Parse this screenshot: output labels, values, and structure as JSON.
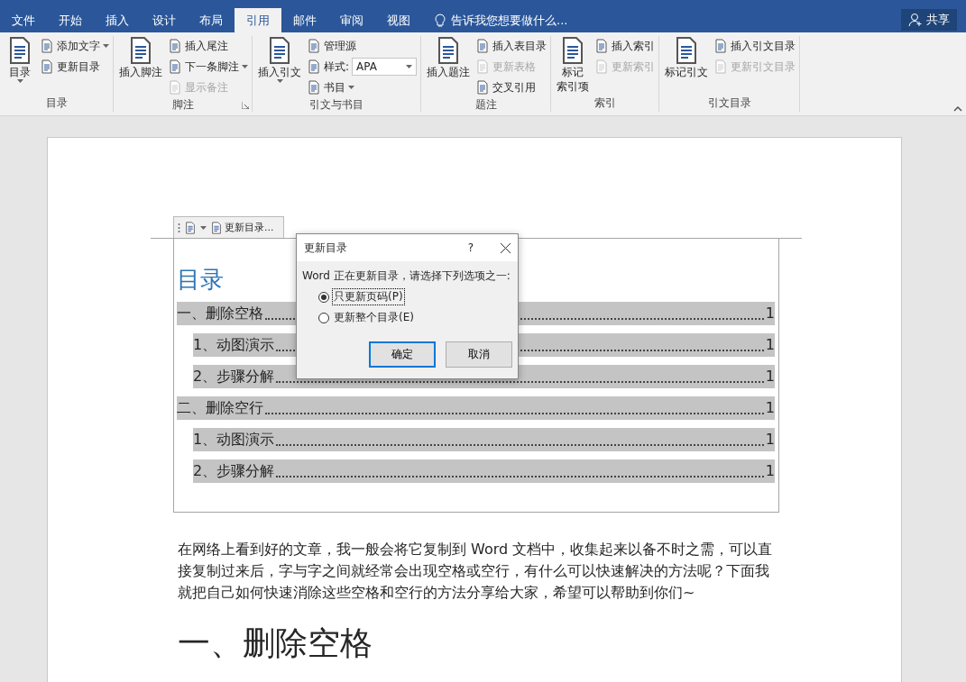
{
  "tabs": [
    {
      "label": "文件",
      "selected": false
    },
    {
      "label": "开始",
      "selected": false
    },
    {
      "label": "插入",
      "selected": false
    },
    {
      "label": "设计",
      "selected": false
    },
    {
      "label": "布局",
      "selected": false
    },
    {
      "label": "引用",
      "selected": true
    },
    {
      "label": "邮件",
      "selected": false
    },
    {
      "label": "审阅",
      "selected": false
    },
    {
      "label": "视图",
      "selected": false
    }
  ],
  "tell_me": "告诉我您想要做什么...",
  "share": "共享",
  "ribbon_groups": [
    {
      "label": "目录",
      "items": [
        {
          "kind": "large",
          "label_lines": [
            "目录"
          ],
          "dropdown": true
        },
        {
          "kind": "small",
          "label": "添加文字",
          "dropdown": true
        },
        {
          "kind": "small",
          "label": "更新目录"
        }
      ]
    },
    {
      "label": "脚注",
      "launcher": true,
      "items": [
        {
          "kind": "large",
          "label_lines": [
            "插入脚注"
          ]
        },
        {
          "kind": "small",
          "label": "插入尾注"
        },
        {
          "kind": "small",
          "label": "下一条脚注",
          "dropdown": true
        },
        {
          "kind": "small",
          "label": "显示备注",
          "disabled": true
        }
      ]
    },
    {
      "label": "引文与书目",
      "items": [
        {
          "kind": "large",
          "label_lines": [
            "插入引文"
          ],
          "dropdown": true
        },
        {
          "kind": "small",
          "label": "管理源"
        },
        {
          "kind": "field",
          "label": "样式:",
          "value": "APA"
        },
        {
          "kind": "small",
          "label": "书目",
          "dropdown": true
        }
      ]
    },
    {
      "label": "题注",
      "items": [
        {
          "kind": "large",
          "label_lines": [
            "插入题注"
          ]
        },
        {
          "kind": "small",
          "label": "插入表目录"
        },
        {
          "kind": "small",
          "label": "更新表格",
          "disabled": true
        },
        {
          "kind": "small",
          "label": "交叉引用"
        }
      ]
    },
    {
      "label": "索引",
      "items": [
        {
          "kind": "large",
          "label_lines": [
            "标记",
            "索引项"
          ]
        },
        {
          "kind": "small",
          "label": "插入索引"
        },
        {
          "kind": "small",
          "label": "更新索引",
          "disabled": true
        }
      ]
    },
    {
      "label": "引文目录",
      "items": [
        {
          "kind": "large",
          "label_lines": [
            "标记引文"
          ]
        },
        {
          "kind": "small",
          "label": "插入引文目录"
        },
        {
          "kind": "small",
          "label": "更新引文目录",
          "disabled": true
        }
      ]
    }
  ],
  "document": {
    "toc_control": {
      "label": "更新目录..."
    },
    "toc_title": "目录",
    "toc_entries": [
      {
        "text": "一、删除空格",
        "page": "1",
        "children": [
          {
            "text": "1、动图演示",
            "page": "1"
          },
          {
            "text": "2、步骤分解",
            "page": "1"
          }
        ]
      },
      {
        "text": "二、删除空行",
        "page": "1",
        "children": [
          {
            "text": "1、动图演示",
            "page": "1"
          },
          {
            "text": "2、步骤分解",
            "page": "1"
          }
        ]
      }
    ],
    "paragraph": "在网络上看到好的文章，我一般会将它复制到 Word 文档中，收集起来以备不时之需，可以直接复制过来后，字与字之间就经常会出现空格或空行，有什么可以快速解决的方法呢？下面我就把自己如何快速消除这些空格和空行的方法分享给大家，希望可以帮助到你们~",
    "heading": "一、删除空格"
  },
  "dialog": {
    "title": "更新目录",
    "help": "?",
    "message": "Word 正在更新目录，请选择下列选项之一:",
    "options": [
      {
        "label": "只更新页码(P)",
        "selected": true
      },
      {
        "label": "更新整个目录(E)",
        "selected": false
      }
    ],
    "buttons": [
      {
        "label": "确定",
        "default": true
      },
      {
        "label": "取消"
      }
    ]
  }
}
